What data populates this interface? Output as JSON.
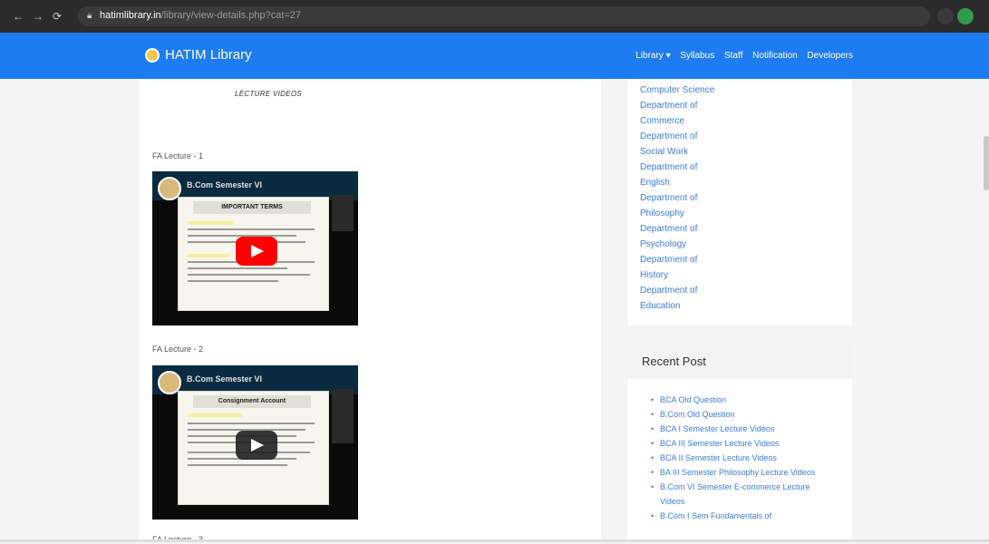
{
  "browser": {
    "url_host": "hatimlibrary.in",
    "url_path": "/library/view-details.php?cat=27"
  },
  "navbar": {
    "brand": "HATIM Library",
    "items": [
      {
        "label": "Library ▾"
      },
      {
        "label": "Syllabus"
      },
      {
        "label": "Staff"
      },
      {
        "label": "Notification"
      },
      {
        "label": "Developers"
      }
    ]
  },
  "main": {
    "heading": "LECTURE VIDEOS",
    "lectures": [
      {
        "label": "FA Lecture - 1",
        "slide_title": "IMPORTANT TERMS",
        "banner": "B.Com Semester VI"
      },
      {
        "label": "FA Lecture - 2",
        "slide_title": "Consignment Account",
        "banner": "B.Com Semester VI"
      },
      {
        "label": "FA Lecture - 3"
      }
    ]
  },
  "sidebar": {
    "departments": [
      "Computer Science",
      "Department of",
      "Commerce",
      "Department of",
      "Social Work",
      "Department of",
      "English",
      "Department of",
      "Philosophy",
      "Department of",
      "Psychology",
      "Department of",
      "History",
      "Department of",
      "Education"
    ],
    "recent_title": "Recent Post",
    "recent_posts": [
      "BCA Old Question",
      "B.Com Old Question",
      "BCA I Semester Lecture Videos",
      "BCA III Semester Lecture Videos",
      "BCA II Semester Lecture Videos",
      "BA III Semester Philosophy Lecture Videos",
      "B.Com VI Semester E-commerce Lecture Videos",
      "B.Com I Sem Fundamentals of"
    ]
  },
  "colors": {
    "navbar": "#1e7cf2",
    "link": "#3c7ce0",
    "youtube_red": "#ff0000"
  }
}
